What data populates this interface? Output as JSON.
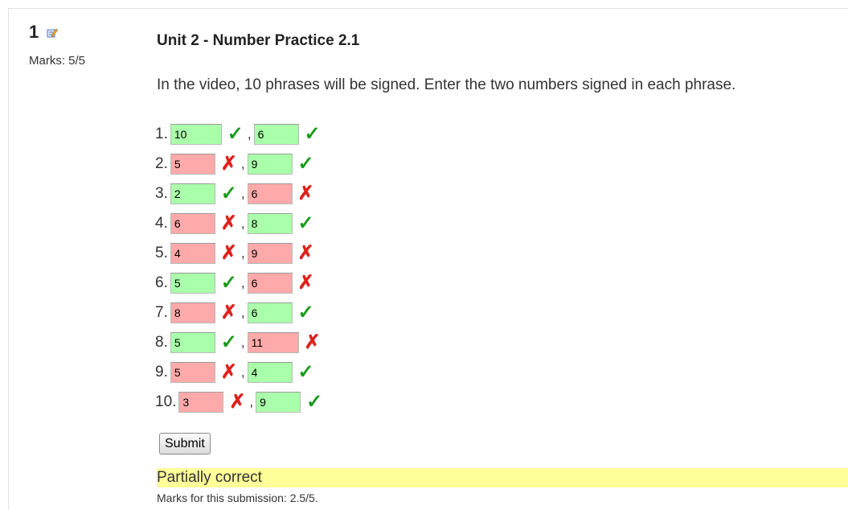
{
  "question": {
    "number": "1",
    "marks": "Marks: 5/5",
    "title": "Unit 2 - Number Practice 2.1",
    "instructions": "In the video, 10 phrases will be signed. Enter the two numbers signed in each phrase."
  },
  "answers": [
    {
      "label": "1.",
      "a": {
        "value": "10",
        "correct": true
      },
      "b": {
        "value": "6",
        "correct": true
      }
    },
    {
      "label": "2.",
      "a": {
        "value": "5",
        "correct": false
      },
      "b": {
        "value": "9",
        "correct": true
      }
    },
    {
      "label": "3.",
      "a": {
        "value": "2",
        "correct": true
      },
      "b": {
        "value": "6",
        "correct": false
      }
    },
    {
      "label": "4.",
      "a": {
        "value": "6",
        "correct": false
      },
      "b": {
        "value": "8",
        "correct": true
      }
    },
    {
      "label": "5.",
      "a": {
        "value": "4",
        "correct": false
      },
      "b": {
        "value": "9",
        "correct": false
      }
    },
    {
      "label": "6.",
      "a": {
        "value": "5",
        "correct": true
      },
      "b": {
        "value": "6",
        "correct": false
      }
    },
    {
      "label": "7.",
      "a": {
        "value": "8",
        "correct": false
      },
      "b": {
        "value": "6",
        "correct": true
      }
    },
    {
      "label": "8.",
      "a": {
        "value": "5",
        "correct": true
      },
      "b": {
        "value": "11",
        "correct": false
      }
    },
    {
      "label": "9.",
      "a": {
        "value": "5",
        "correct": false
      },
      "b": {
        "value": "4",
        "correct": true
      }
    },
    {
      "label": "10.",
      "a": {
        "value": "3",
        "correct": false
      },
      "b": {
        "value": "9",
        "correct": true
      }
    }
  ],
  "separator": ",",
  "tick_glyph": "✓",
  "cross_glyph": "✗",
  "submit_label": "Submit",
  "feedback": {
    "status": "Partially correct",
    "submission_marks": "Marks for this submission: 2.5/5."
  },
  "colors": {
    "correct_bg": "#aaffaa",
    "incorrect_bg": "#ffaaaa",
    "tick": "#1a9b1a",
    "cross": "#e0201a",
    "feedback_bg": "#ffff99"
  },
  "icons": {
    "edit": "edit-pencil-icon",
    "correct": "check-icon",
    "incorrect": "cross-icon"
  }
}
